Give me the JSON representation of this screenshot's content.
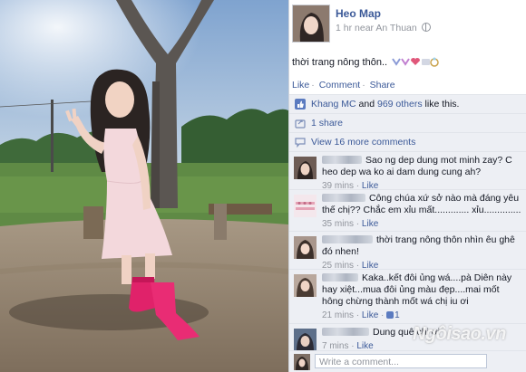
{
  "post": {
    "author": "Heo Map",
    "time": "1 hr near An Thuan",
    "text": "thời trang nông thôn.."
  },
  "actions": {
    "like": "Like",
    "comment": "Comment",
    "share": "Share"
  },
  "likes": {
    "first": "Khang MC",
    "and": "and",
    "others": "969 others",
    "suffix": "like this."
  },
  "shares": "1 share",
  "view_comments": "View 16 more comments",
  "comments": [
    {
      "text": "Sao ng dep dung mot minh zay? C heo dep wa ko ai dam dung cung ah?",
      "time": "39 mins",
      "like": "Like",
      "likes_count": ""
    },
    {
      "text": "Công chúa xứ sở nào mà đáng yêu thế chị?? Chắc em xỉu mất............. xỉu..............",
      "time": "35 mins",
      "like": "Like",
      "likes_count": ""
    },
    {
      "text": "thời trang nông thôn nhìn êu ghê đó nhen!",
      "time": "25 mins",
      "like": "Like",
      "likes_count": ""
    },
    {
      "text": "Kaka..kết đôi ủng wá....pà Diên này hay xiệt...mua đôi ủng màu đẹp....mai mốt hông chừng thành mốt wá chị iu ơi",
      "time": "21 mins",
      "like": "Like",
      "likes_count": "1"
    },
    {
      "text": "Dung quê chị ơi",
      "time": "7 mins",
      "like": "Like",
      "likes_count": ""
    }
  ],
  "write_placeholder": "Write a comment...",
  "watermark": "Ngôisao.vn",
  "colors": {
    "link": "#3b5998",
    "panel_bg": "#edeff4",
    "meta": "#90949c"
  }
}
